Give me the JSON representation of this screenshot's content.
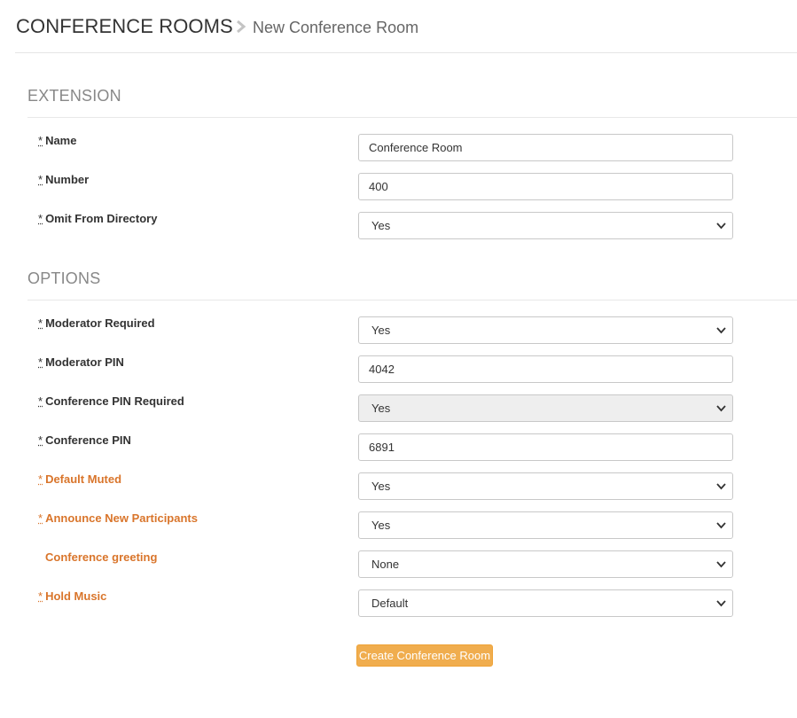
{
  "breadcrumb": {
    "section": "CONFERENCE ROOMS",
    "separator_icon": "chevron-right-icon",
    "page": "New Conference Room"
  },
  "extension": {
    "title": "EXTENSION",
    "fields": [
      {
        "label": "Name",
        "required": true,
        "type": "input",
        "value": "Conference Room"
      },
      {
        "label": "Number",
        "required": true,
        "type": "input",
        "value": "400"
      },
      {
        "label": "Omit From Directory",
        "required": true,
        "type": "select",
        "value": "Yes"
      }
    ]
  },
  "options": {
    "title": "OPTIONS",
    "fields": [
      {
        "label": "Moderator Required",
        "required": true,
        "type": "select",
        "value": "Yes"
      },
      {
        "label": "Moderator PIN",
        "required": true,
        "type": "input",
        "value": "4042"
      },
      {
        "label": "Conference PIN Required",
        "required": true,
        "type": "select",
        "value": "Yes",
        "disabled": true
      },
      {
        "label": "Conference PIN",
        "required": true,
        "type": "input",
        "value": "6891"
      },
      {
        "label": "Default Muted",
        "required": true,
        "type": "select",
        "value": "Yes",
        "highlight": true
      },
      {
        "label": "Announce New Participants",
        "required": true,
        "type": "select",
        "value": "Yes",
        "highlight": true
      },
      {
        "label": "Conference greeting",
        "required": false,
        "type": "select",
        "value": "None",
        "highlight": true
      },
      {
        "label": "Hold Music",
        "required": true,
        "type": "select",
        "value": "Default",
        "highlight": true
      }
    ]
  },
  "required_marker": "*",
  "submit_label": "Create Conference Room",
  "colors": {
    "accent_orange": "#d9752b",
    "button": "#f0ad4e",
    "section_title": "#888888",
    "disabled_field": "#eeeeee"
  }
}
